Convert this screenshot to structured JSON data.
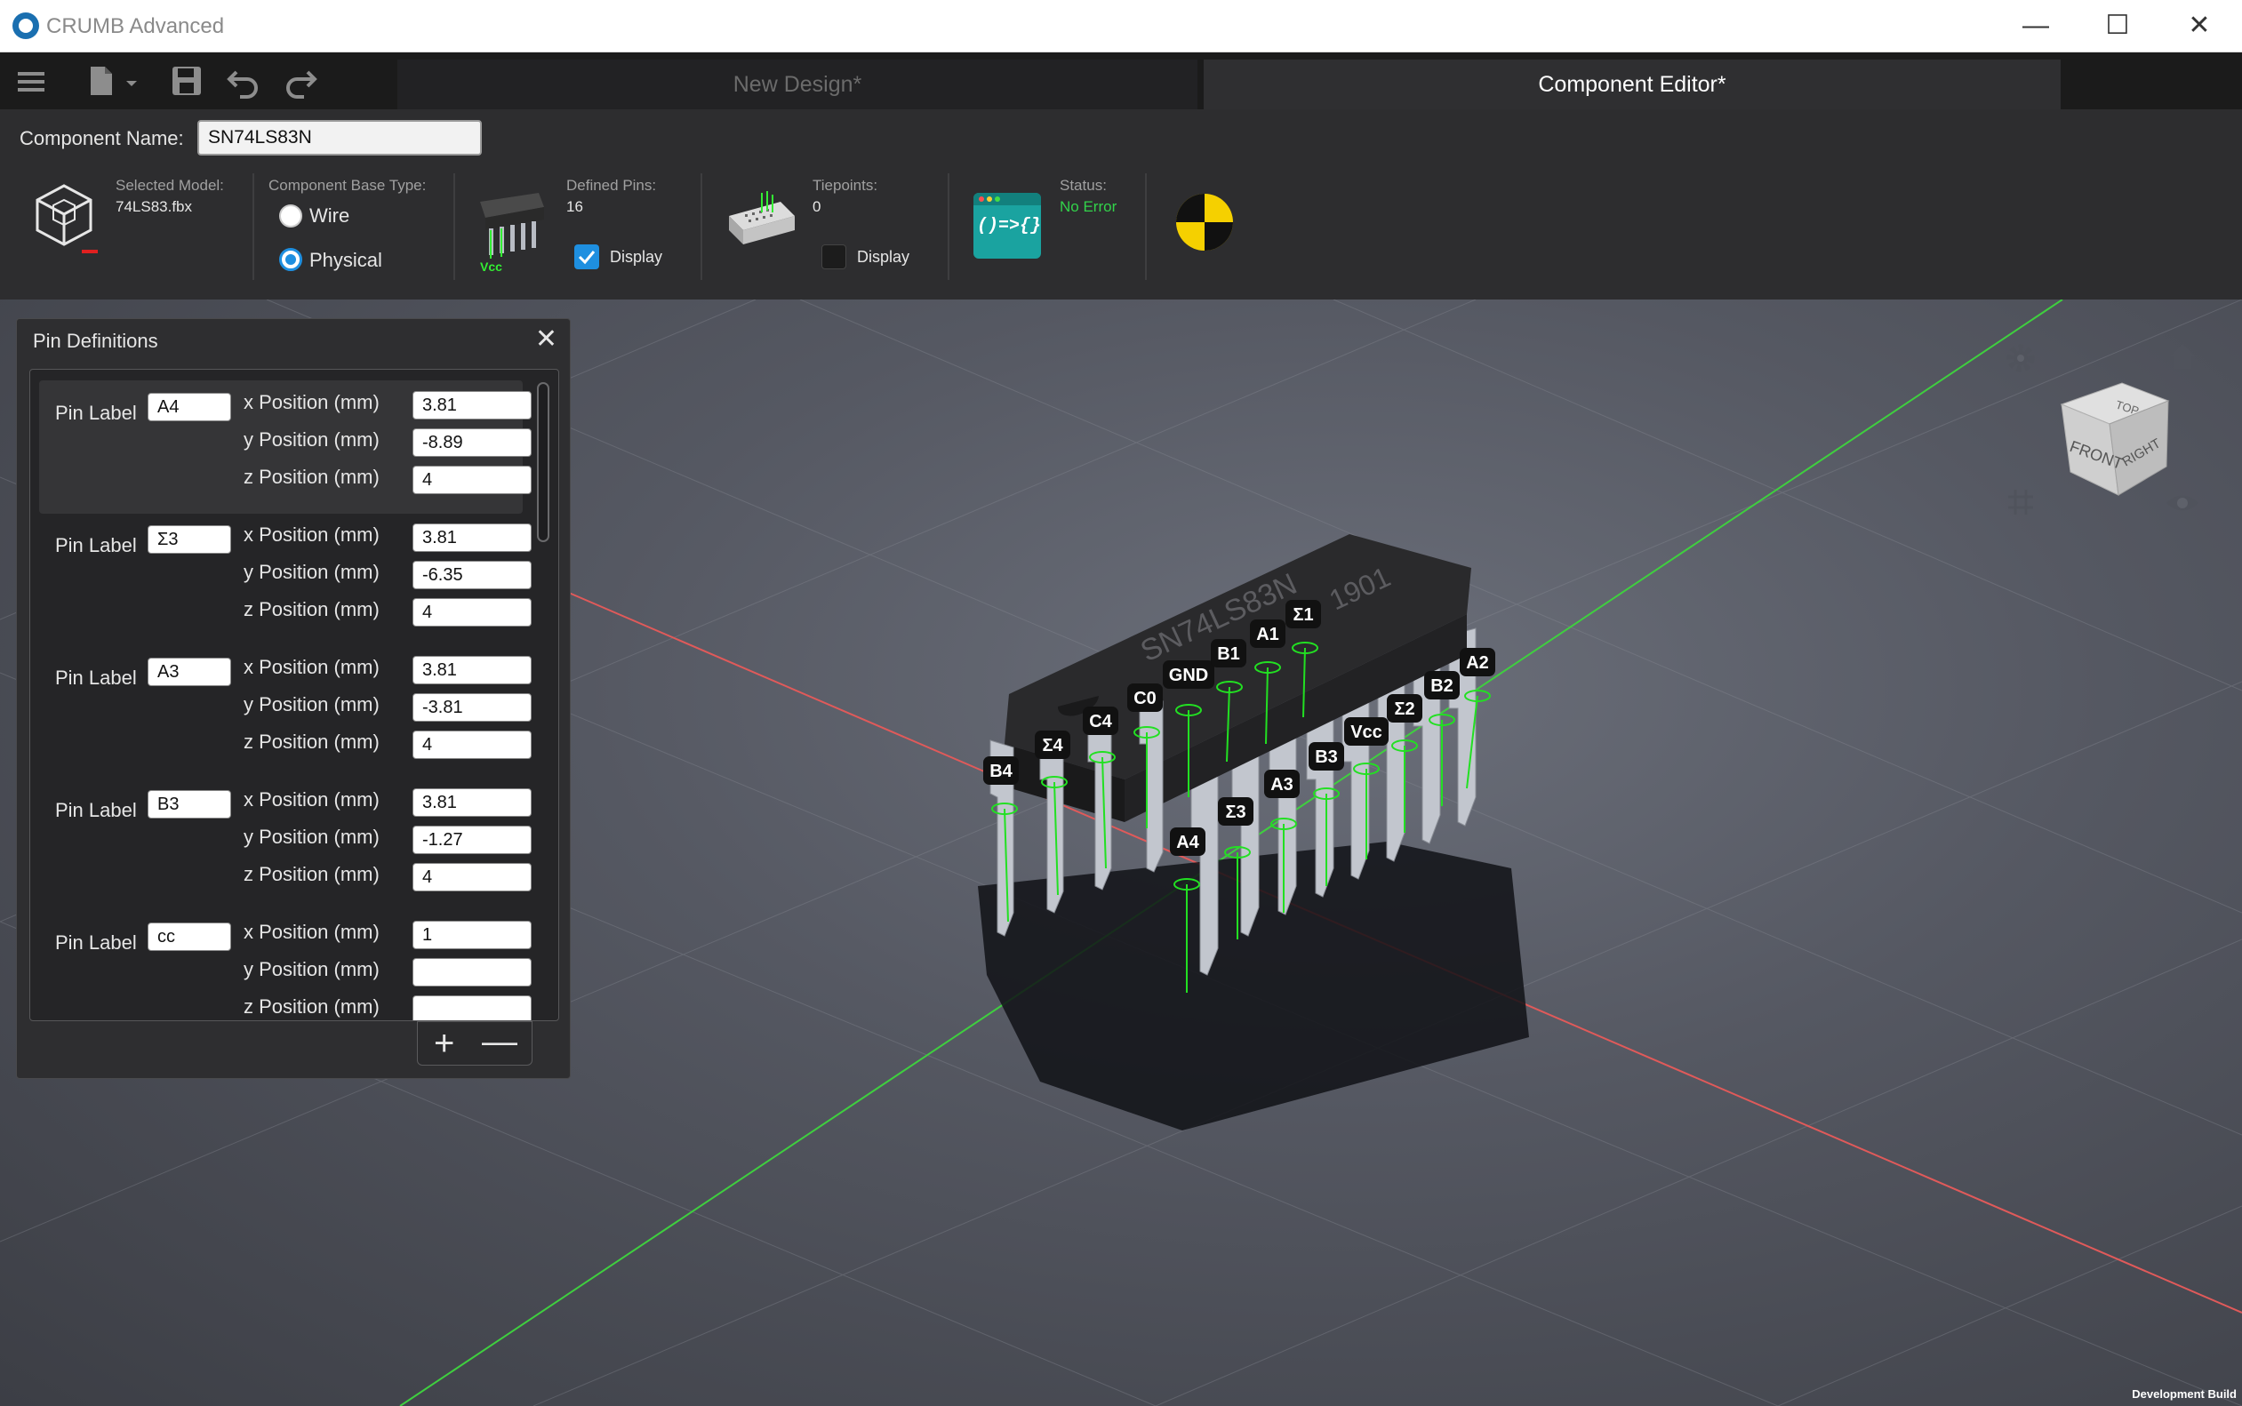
{
  "app": {
    "title": "CRUMB Advanced"
  },
  "window_controls": {
    "minimize": "—",
    "maximize": "☐",
    "close": "✕"
  },
  "tabs": [
    {
      "label": "New Design*",
      "active": false
    },
    {
      "label": "Component Editor*",
      "active": true
    }
  ],
  "component": {
    "name_label": "Component Name:",
    "name_value": "SN74LS83N",
    "selected_model_label": "Selected Model:",
    "selected_model_value": "74LS83.fbx",
    "base_type_label": "Component Base Type:",
    "base_type_options": [
      "Wire",
      "Physical"
    ],
    "base_type_selected": "Physical",
    "defined_pins_label": "Defined Pins:",
    "defined_pins_value": "16",
    "defined_pins_display_label": "Display",
    "defined_pins_display_checked": true,
    "pins_icon_caption": "Vcc",
    "tiepoints_label": "Tiepoints:",
    "tiepoints_value": "0",
    "tiepoints_display_label": "Display",
    "tiepoints_display_checked": false,
    "script_icon_text": "()=>{}",
    "status_label": "Status:",
    "status_value": "No Error",
    "status_color": "#32d24a"
  },
  "pin_panel": {
    "title": "Pin Definitions",
    "pin_label_text": "Pin Label",
    "x_label": "x Position (mm)",
    "y_label": "y Position (mm)",
    "z_label": "z Position (mm)",
    "pins": [
      {
        "label": "A4",
        "x": "3.81",
        "y": "-8.89",
        "z": "4",
        "selected": true
      },
      {
        "label": "Σ3",
        "x": "3.81",
        "y": "-6.35",
        "z": "4",
        "selected": false
      },
      {
        "label": "A3",
        "x": "3.81",
        "y": "-3.81",
        "z": "4",
        "selected": false
      },
      {
        "label": "B3",
        "x": "3.81",
        "y": "-1.27",
        "z": "4",
        "selected": false
      },
      {
        "label": "cc",
        "x": "1",
        "y": "",
        "z": "",
        "selected": false
      }
    ],
    "add_symbol": "+",
    "remove_symbol": "—"
  },
  "chip": {
    "marking": "SN74LS83N",
    "date_code": "1901",
    "pin_labels_front": [
      "B4",
      "Σ4",
      "C4",
      "C0",
      "GND",
      "B1",
      "A1",
      "Σ1"
    ],
    "pin_labels_back": [
      "A4",
      "Σ3",
      "A3",
      "B3",
      "Vcc",
      "Σ2",
      "B2",
      "A2"
    ]
  },
  "nav_cube": {
    "top": "TOP",
    "front": "FRONT",
    "right": "RIGHT"
  },
  "footer": {
    "build_label": "Development Build"
  },
  "colors": {
    "accent": "#1e8fe0",
    "pin_marker": "#22e022",
    "x_axis": "#e05a5a",
    "y_axis": "#3fcf3f"
  }
}
